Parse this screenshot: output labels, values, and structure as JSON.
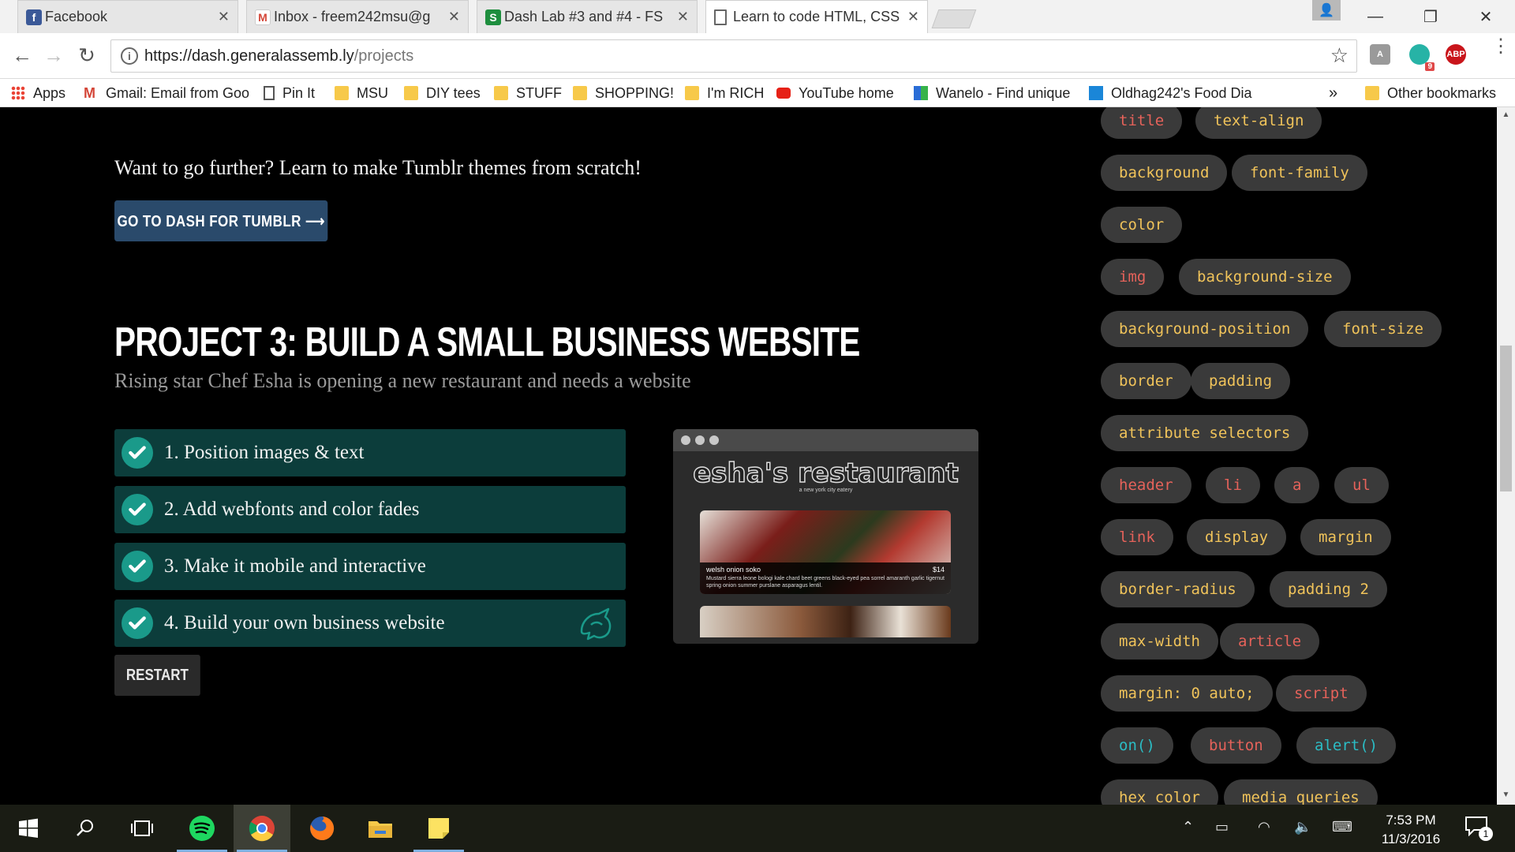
{
  "browser": {
    "tabs": [
      {
        "title": "Facebook",
        "icon": "facebook-icon",
        "color": "#3b5998"
      },
      {
        "title": "Inbox - freem242msu@g",
        "icon": "gmail-icon",
        "color": "#d44638"
      },
      {
        "title": "Dash Lab #3 and #4 - FS",
        "icon": "sheets-icon",
        "color": "#1e8e3e"
      },
      {
        "title": "Learn to code HTML, CSS",
        "icon": "page-icon",
        "color": "#666666"
      }
    ],
    "url_host": "https://dash.generalassemb.ly",
    "url_path": "/projects",
    "extensions": {
      "abp": "ABP",
      "badge": "9"
    },
    "bookmarks": [
      {
        "label": "Apps",
        "icon": "apps-grid-icon"
      },
      {
        "label": "Gmail: Email from Goo",
        "icon": "gmail-icon"
      },
      {
        "label": "Pin It",
        "icon": "page-icon"
      },
      {
        "label": "MSU",
        "icon": "folder-icon"
      },
      {
        "label": "DIY tees",
        "icon": "folder-icon"
      },
      {
        "label": "STUFF",
        "icon": "folder-icon"
      },
      {
        "label": "SHOPPING!",
        "icon": "folder-icon"
      },
      {
        "label": "I'm RICH",
        "icon": "folder-icon"
      },
      {
        "label": "YouTube home",
        "icon": "youtube-icon"
      },
      {
        "label": "Wanelo - Find unique",
        "icon": "wanelo-icon"
      },
      {
        "label": "Oldhag242's Food Dia",
        "icon": "blog-icon"
      }
    ],
    "bookmarks_overflow": "»",
    "other_bookmarks": "Other bookmarks"
  },
  "page": {
    "promo_text": "Want to go further? Learn to make Tumblr themes from scratch!",
    "dash_button": "GO TO DASH FOR TUMBLR ⟶",
    "project_title": "PROJECT 3: BUILD A SMALL BUSINESS WEBSITE",
    "project_subtitle": "Rising star Chef Esha is opening a new restaurant and needs a website",
    "steps": [
      "1. Position images & text",
      "2. Add webfonts and color fades",
      "3. Make it mobile and interactive",
      "4. Build your own business website"
    ],
    "restart_button": "RESTART",
    "preview": {
      "title": "esha's restaurant",
      "subtitle": "a new york city eatery",
      "dish_name": "welsh onion soko",
      "dish_price": "$14",
      "dish_desc": "Mustard sierra leone bologi kale chard beet greens black-eyed pea sorrel amaranth garlic tigernut spring onion summer purslane asparagus lentil."
    },
    "tags": [
      {
        "label": "title",
        "color": "red"
      },
      {
        "label": "text-align",
        "color": "yellow"
      },
      {
        "label": "background",
        "color": "yellow"
      },
      {
        "label": "font-family",
        "color": "yellow"
      },
      {
        "label": "color",
        "color": "yellow"
      },
      {
        "label": "img",
        "color": "red"
      },
      {
        "label": "background-size",
        "color": "yellow"
      },
      {
        "label": "background-position",
        "color": "yellow"
      },
      {
        "label": "font-size",
        "color": "yellow"
      },
      {
        "label": "border",
        "color": "yellow"
      },
      {
        "label": "padding",
        "color": "yellow"
      },
      {
        "label": "attribute selectors",
        "color": "yellow"
      },
      {
        "label": "header",
        "color": "red"
      },
      {
        "label": "li",
        "color": "red"
      },
      {
        "label": "a",
        "color": "red"
      },
      {
        "label": "ul",
        "color": "red"
      },
      {
        "label": "link",
        "color": "red"
      },
      {
        "label": "display",
        "color": "yellow"
      },
      {
        "label": "margin",
        "color": "yellow"
      },
      {
        "label": "border-radius",
        "color": "yellow"
      },
      {
        "label": "padding 2",
        "color": "yellow"
      },
      {
        "label": "max-width",
        "color": "yellow"
      },
      {
        "label": "article",
        "color": "red"
      },
      {
        "label": "margin: 0 auto;",
        "color": "yellow"
      },
      {
        "label": "script",
        "color": "red"
      },
      {
        "label": "on()",
        "color": "teal"
      },
      {
        "label": "button",
        "color": "red"
      },
      {
        "label": "alert()",
        "color": "teal"
      },
      {
        "label": "hex color",
        "color": "yellow"
      },
      {
        "label": "media queries",
        "color": "yellow"
      }
    ]
  },
  "taskbar": {
    "time": "7:53 PM",
    "date": "11/3/2016",
    "notification_count": "1"
  },
  "colors": {
    "accent_teal": "#1a9a8a",
    "step_bg": "#0c3d3b",
    "dash_button_bg": "#2a4a6b",
    "tag_yellow": "#f0c35a",
    "tag_red": "#e5625a",
    "tag_teal": "#2bbcc4"
  }
}
